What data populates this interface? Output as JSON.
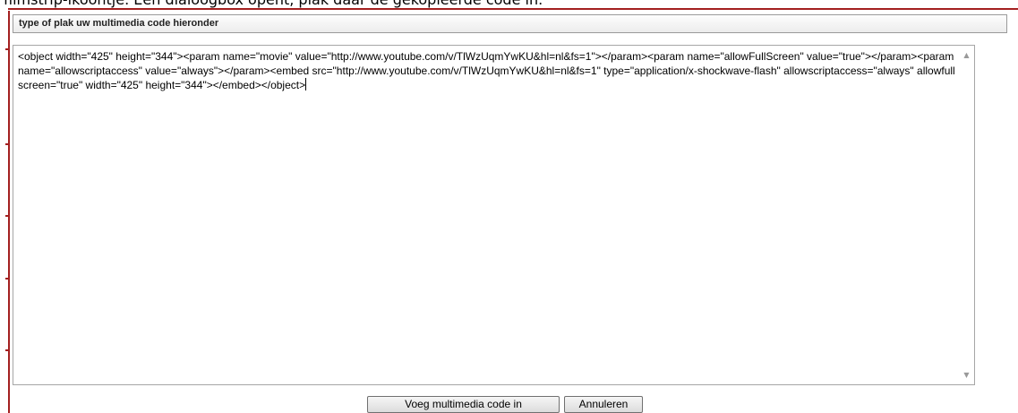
{
  "page": {
    "top_caption": "filmstrip-ikoontje. Een dialoogbox opent, plak daar de gekopieerde code in."
  },
  "dialog": {
    "header": "type of plak uw multimedia code hieronder",
    "code_text": "<object width=\"425\" height=\"344\"><param name=\"movie\" value=\"http://www.youtube.com/v/TlWzUqmYwKU&hl=nl&fs=1\"></param><param name=\"allowFullScreen\" value=\"true\"></param><param name=\"allowscriptaccess\" value=\"always\"></param><embed src=\"http://www.youtube.com/v/TlWzUqmYwKU&hl=nl&fs=1\" type=\"application/x-shockwave-flash\" allowscriptaccess=\"always\" allowfullscreen=\"true\" width=\"425\" height=\"344\"></embed></object>",
    "buttons": {
      "insert_label": "Voeg multimedia code in",
      "cancel_label": "Annuleren"
    }
  },
  "icons": {
    "scroll_up": "scroll-up-arrow",
    "scroll_down": "scroll-down-arrow"
  },
  "colors": {
    "frame_border": "#a31f1f"
  }
}
